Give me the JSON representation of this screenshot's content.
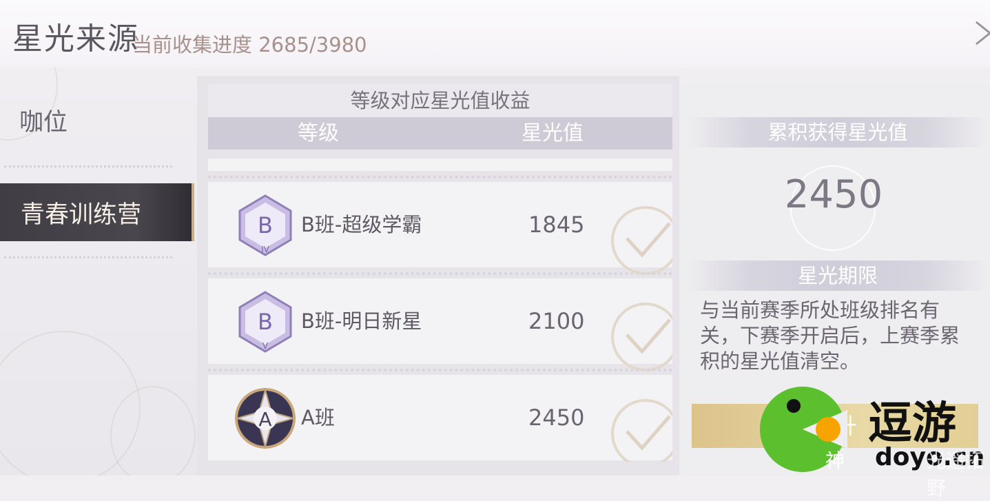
{
  "header": {
    "title": "星光来源",
    "progress_label": "当前收集进度",
    "progress_value": "2685/3980"
  },
  "sidebar": {
    "items": [
      {
        "label": "咖位",
        "selected": false
      },
      {
        "label": "青春训练营",
        "selected": true
      }
    ]
  },
  "table": {
    "caption": "等级对应星光值收益",
    "headers": [
      "等级",
      "星光值"
    ],
    "rows": [
      {
        "badge_letter": "B",
        "badge_sub": "IV",
        "name": "B班-超级学霸",
        "value": "1845",
        "claimed": true
      },
      {
        "badge_letter": "B",
        "badge_sub": "V",
        "name": "B班-明日新星",
        "value": "2100",
        "claimed": true
      },
      {
        "badge_letter": "A",
        "badge_sub": "",
        "name": "A班",
        "value": "2450",
        "claimed": true
      }
    ]
  },
  "info": {
    "total_label": "累积获得星光值",
    "total_value": "2450",
    "expiry_label": "星光期限",
    "expiry_desc": "与当前赛季所处班级排名有关，下赛季开启后，上赛季累积的星光值清空。",
    "upgrade_button": "提升"
  },
  "watermark": {
    "brand": "逗游",
    "site": "doyo.cn",
    "prefix": "神",
    "faint": "光遥拓野"
  },
  "colors": {
    "accent_gold": "#c9ad84",
    "selected_bg": "#403d44",
    "header_row": "#cecbd6"
  }
}
